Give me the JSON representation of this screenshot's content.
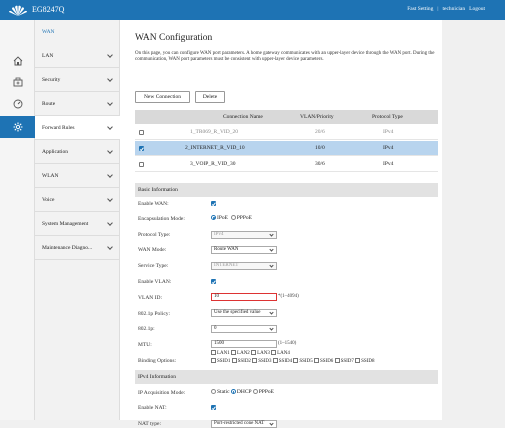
{
  "header": {
    "brand": "EG8247Q",
    "links": [
      "Fast Setting",
      "technician",
      "Logout"
    ],
    "brand_color": "#1e73b4"
  },
  "sidebar_icons": [
    "home-icon",
    "printer-icon",
    "gauge-icon",
    "gear-icon"
  ],
  "menu": {
    "header": "WAN",
    "items": [
      {
        "label": "LAN"
      },
      {
        "label": "Security"
      },
      {
        "label": "Route"
      },
      {
        "label": "Forward Rules"
      },
      {
        "label": "Application"
      },
      {
        "label": "WLAN"
      },
      {
        "label": "Voice"
      },
      {
        "label": "System Management"
      },
      {
        "label": "Maintenance Diagno..."
      }
    ]
  },
  "main": {
    "title": "WAN Configuration",
    "description": "On this page, you can configure WAN port parameters. A home gateway communicates with an upper-layer device through the WAN port. During the communication, WAN port parameters must be consistent with upper-layer device parameters.",
    "new_connection": "New Connection",
    "delete": "Delete"
  },
  "table": {
    "headers": [
      "Connection Name",
      "VLAN/Priority",
      "Protocol Type"
    ],
    "rows": [
      {
        "name": "1_TR069_R_VID_20",
        "vlan": "20/6",
        "proto": "IPv4"
      },
      {
        "name": "2_INTERNET_R_VID_10",
        "vlan": "10/0",
        "proto": "IPv4"
      },
      {
        "name": "3_VOIP_R_VID_30",
        "vlan": "30/6",
        "proto": "IPv4"
      }
    ]
  },
  "basic": {
    "section": "Basic Information",
    "enable_wan": "Enable WAN:",
    "encap_label": "Encapsulation Mode:",
    "encap_opts": [
      "IPoE",
      "PPPoE"
    ],
    "protocol_label": "Protocol Type:",
    "protocol_value": "IPv4",
    "wan_mode_label": "WAN Mode:",
    "wan_mode_value": "Route WAN",
    "service_label": "Service Type:",
    "service_value": "INTERNET",
    "enable_vlan": "Enable VLAN:",
    "vlan_id_label": "VLAN ID:",
    "vlan_id_value": "10",
    "vlan_id_hint": "*(1–4094)",
    "policy_label": "802.1p Policy:",
    "policy_value": "Use the specified value",
    "p_label": "802.1p:",
    "p_value": "0",
    "mtu_label": "MTU:",
    "mtu_value": "1500",
    "mtu_hint": "(1–1540)",
    "binding_label": "Binding Options:",
    "binding_lan": [
      "LAN1",
      "LAN2",
      "LAN3",
      "LAN4"
    ],
    "binding_ssid": [
      "SSID1",
      "SSID2",
      "SSID3",
      "SSID4",
      "SSID5",
      "SSID6",
      "SSID7",
      "SSID8"
    ]
  },
  "ipv4": {
    "section": "IPv4 Information",
    "acq_label": "IP Acquisition Mode:",
    "acq_opts": [
      "Static",
      "DHCP",
      "PPPoE"
    ],
    "nat_label": "Enable NAT:",
    "nat_type_label": "NAT type:",
    "nat_type_value": "Port-restricted cone NAT"
  }
}
